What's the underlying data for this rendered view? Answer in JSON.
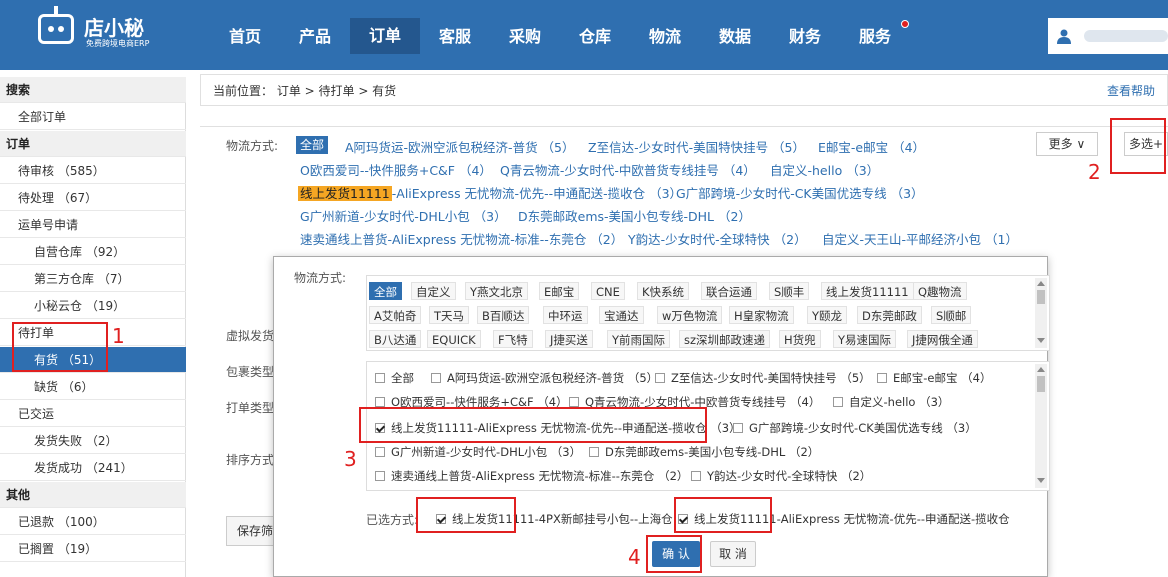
{
  "header": {
    "logo_name": "店小秘",
    "logo_sub": "免费跨境电商ERP",
    "nav": [
      "首页",
      "产品",
      "订单",
      "客服",
      "采购",
      "仓库",
      "物流",
      "数据",
      "财务",
      "服务"
    ],
    "active_nav": "订单"
  },
  "sidebar": {
    "search": "搜索",
    "all_orders": "全部订单",
    "orders_group": "订单",
    "pending_review": "待审核 （585）",
    "pending_process": "待处理 （67）",
    "tracking_apply": "运单号申请",
    "own_warehouse": "自营仓库 （92）",
    "third_warehouse": "第三方仓库 （7）",
    "cloud_warehouse": "小秘云仓 （19）",
    "to_print": "待打单",
    "in_stock": "有货 （51）",
    "out_stock": "缺货 （6）",
    "shipped": "已交运",
    "ship_fail": "发货失败 （2）",
    "ship_success": "发货成功 （241）",
    "other_group": "其他",
    "refunded": "已退款 （100）",
    "on_hold": "已搁置 （19）"
  },
  "breadcrumb": {
    "text": "当前位置： 订单 > 待打单 > 有货",
    "help": "查看帮助"
  },
  "filter": {
    "logistics_label": "物流方式:",
    "all": "全部",
    "row1": [
      "A阿玛货运-欧洲空派包税经济-普货 （5）",
      "Z至信达-少女时代-美国特快挂号 （5）",
      "E邮宝-e邮宝 （4）"
    ],
    "row2": [
      "O欧西爱司--快件服务+C&F （4）",
      "Q青云物流-少女时代-中欧普货专线挂号 （4）",
      "自定义-hello （3）"
    ],
    "row3_highlight": "线上发货11111",
    "row3_rest": "-AliExpress 无忧物流-优先--申通配送-揽收仓 （3）",
    "row3_b": "G广部跨境-少女时代-CK美国优选专线 （3）",
    "row4": [
      "G广州新道-少女时代-DHL小包 （3）",
      "D东莞邮政ems-美国小包专线-DHL （2）"
    ],
    "row5": [
      "速卖通线上普货-AliExpress 无忧物流-标准--东莞仓 （2）",
      "Y韵达-少女时代-全球特快 （2）",
      "自定义-天王山-平邮经济小包 （1）"
    ],
    "more": "更多",
    "multi": "多选",
    "virtual_ship_label": "虚拟发货",
    "package_type_label": "包裹类型",
    "print_type_label": "打单类型",
    "sort_label": "排序方式",
    "save_btn": "保存筛"
  },
  "modal": {
    "label": "物流方式:",
    "tags_row1": [
      "全部",
      "自定义",
      "Y燕文北京",
      "E邮宝",
      "CNE",
      "K快系统",
      "联合运通",
      "S顺丰",
      "线上发货11111",
      "Q趣物流"
    ],
    "tags_row2": [
      "A艾帕奇",
      "T天马",
      "B百顺达",
      "中环运",
      "宝通达",
      "w万色物流",
      "H皇家物流",
      "Y颐龙",
      "D东莞邮政",
      "S顺邮"
    ],
    "tags_row3": [
      "B八达通",
      "EQUICK",
      "F飞特",
      "J捷买送",
      "Y前雨国际",
      "sz深圳邮政速递",
      "H货兜",
      "Y易速国际",
      "J捷网俄全通"
    ],
    "options": [
      {
        "text": "全部",
        "checked": false
      },
      {
        "text": "A阿玛货运-欧洲空派包税经济-普货 （5）",
        "checked": false
      },
      {
        "text": "Z至信达-少女时代-美国特快挂号 （5）",
        "checked": false
      },
      {
        "text": "E邮宝-e邮宝 （4）",
        "checked": false
      },
      {
        "text": "O欧西爱司--快件服务+C&F （4）",
        "checked": false
      },
      {
        "text": "Q青云物流-少女时代-中欧普货专线挂号 （4）",
        "checked": false
      },
      {
        "text": "自定义-hello （3）",
        "checked": false
      },
      {
        "text": "线上发货11111-AliExpress 无忧物流-优先--申通配送-揽收仓 （3）",
        "checked": true
      },
      {
        "text": "G广部跨境-少女时代-CK美国优选专线 （3）",
        "checked": false
      },
      {
        "text": "G广州新道-少女时代-DHL小包 （3）",
        "checked": false
      },
      {
        "text": "D东莞邮政ems-美国小包专线-DHL （2）",
        "checked": false
      },
      {
        "text": "速卖通线上普货-AliExpress 无忧物流-标准--东莞仓 （2）",
        "checked": false
      },
      {
        "text": "Y韵达-少女时代-全球特快 （2）",
        "checked": false
      }
    ],
    "selected_label": "已选方式:",
    "selected": [
      "线上发货11111-4PX新邮挂号小包--上海仓",
      "线上发货11111-AliExpress 无忧物流-优先--申通配送-揽收仓"
    ],
    "ok": "确 认",
    "cancel": "取 消"
  },
  "annotations": [
    "1",
    "2",
    "3",
    "4"
  ],
  "colors": {
    "brand": "#2f6fb0",
    "accent_red": "#e02020",
    "highlight": "#f5a623"
  }
}
